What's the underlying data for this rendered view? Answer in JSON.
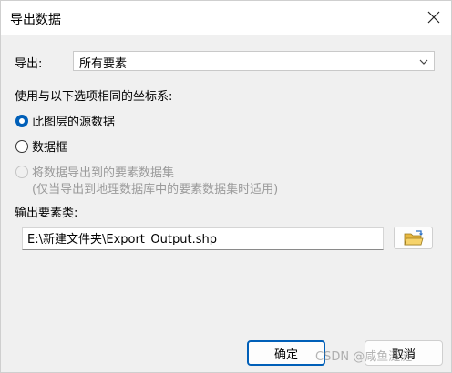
{
  "window": {
    "title": "导出数据"
  },
  "export": {
    "label": "导出:",
    "selected": "所有要素"
  },
  "coord": {
    "heading": "使用与以下选项相同的坐标系:"
  },
  "options": {
    "source": "此图层的源数据",
    "frame": "数据框",
    "dataset_line1": "将数据导出到的要素数据集",
    "dataset_line2": "(仅当导出到地理数据库中的要素数据集时适用)"
  },
  "output": {
    "label": "输出要素类:",
    "path": "E:\\新建文件夹\\Export_Output.shp"
  },
  "buttons": {
    "ok": "确定",
    "cancel": "取消"
  },
  "watermark": "CSDN @咸鱼涟涟",
  "colors": {
    "accent": "#005fb8",
    "disabled": "#9a9a9a"
  }
}
